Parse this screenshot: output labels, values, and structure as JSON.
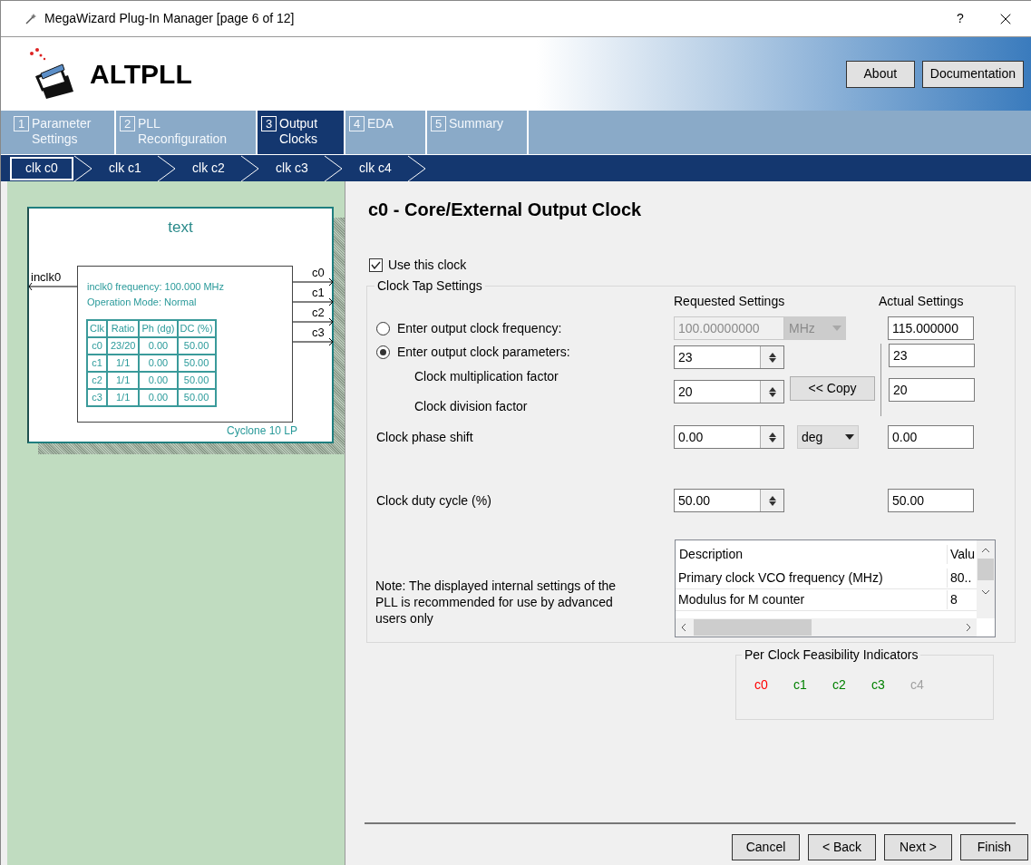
{
  "window": {
    "title": "MegaWizard Plug-In Manager [page 6 of 12]",
    "help": "?"
  },
  "header": {
    "title": "ALTPLL",
    "buttons": [
      "About",
      "Documentation"
    ]
  },
  "steps": [
    {
      "number": "1",
      "lines": [
        "Parameter",
        "Settings"
      ],
      "selected": false
    },
    {
      "number": "2",
      "lines": [
        "PLL",
        "Reconfiguration"
      ],
      "selected": false
    },
    {
      "number": "3",
      "lines": [
        "Output",
        "Clocks"
      ],
      "selected": true
    },
    {
      "number": "4",
      "lines": [
        "EDA"
      ],
      "selected": false
    },
    {
      "number": "5",
      "lines": [
        "Summary"
      ],
      "selected": false
    }
  ],
  "clocks": [
    {
      "label": "clk c0",
      "selected": true
    },
    {
      "label": "clk c1",
      "selected": false
    },
    {
      "label": "clk c2",
      "selected": false
    },
    {
      "label": "clk c3",
      "selected": false
    },
    {
      "label": "clk c4",
      "selected": false
    }
  ],
  "diagram": {
    "title": "text",
    "input": "inclk0",
    "info": [
      "inclk0 frequency: 100.000 MHz",
      "Operation Mode: Normal"
    ],
    "columns": [
      "Clk",
      "Ratio",
      "Ph (dg)",
      "DC (%)"
    ],
    "rows": [
      [
        "c0",
        "23/20",
        "0.00",
        "50.00"
      ],
      [
        "c1",
        "1/1",
        "0.00",
        "50.00"
      ],
      [
        "c2",
        "1/1",
        "0.00",
        "50.00"
      ],
      [
        "c3",
        "1/1",
        "0.00",
        "50.00"
      ]
    ],
    "outputs": [
      "c0",
      "c1",
      "c2",
      "c3"
    ],
    "device": "Cyclone 10 LP"
  },
  "section_title": "c0 - Core/External Output Clock",
  "use_clock": {
    "label": "Use this clock",
    "checked": true
  },
  "clock_tap": {
    "title": "Clock Tap Settings",
    "requested_heading": "Requested Settings",
    "actual_heading": "Actual Settings",
    "frequency": {
      "label": "Enter output clock frequency:",
      "selected": false,
      "value": "100.00000000",
      "unit": "MHz",
      "disabled": true,
      "actual": "115.000000"
    },
    "parameters": {
      "label": "Enter output clock parameters:",
      "selected": true
    },
    "multiplication": {
      "label": "Clock multiplication factor",
      "value": "23",
      "actual": "23"
    },
    "division": {
      "label": "Clock division factor",
      "value": "20",
      "actual": "20"
    },
    "copy_button": "<< Copy",
    "phase": {
      "label": "Clock phase shift",
      "value": "0.00",
      "unit": "deg",
      "actual": "0.00"
    },
    "duty": {
      "label": "Clock duty cycle (%)",
      "value": "50.00",
      "actual": "50.00"
    },
    "note": "Note: The displayed internal settings of the PLL is recommended for use by advanced users only",
    "internal_table": {
      "columns": [
        "Description",
        "Valu"
      ],
      "rows": [
        [
          "Primary clock VCO frequency (MHz)",
          "80.."
        ],
        [
          "Modulus for M counter",
          "8"
        ]
      ]
    }
  },
  "feasibility": {
    "title": "Per Clock Feasibility Indicators",
    "clocks": [
      {
        "label": "c0",
        "color": "#ff0000"
      },
      {
        "label": "c1",
        "color": "#008000"
      },
      {
        "label": "c2",
        "color": "#008000"
      },
      {
        "label": "c3",
        "color": "#008000"
      },
      {
        "label": "c4",
        "color": "#a0a0a0"
      }
    ]
  },
  "buttons": [
    "Cancel",
    "< Back",
    "Next >",
    "Finish"
  ]
}
